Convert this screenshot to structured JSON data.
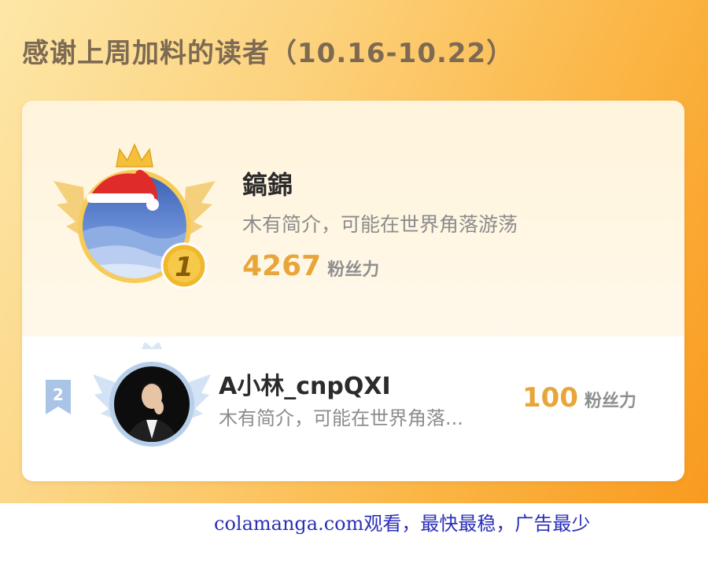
{
  "headline": "感谢上周加料的读者（10.16-10.22）",
  "leaderboard": [
    {
      "rank": "1",
      "name": "鎬錦",
      "bio": "木有简介，可能在世界角落游荡",
      "fans_value": "4267",
      "fans_unit": "粉丝力"
    },
    {
      "rank": "2",
      "name": "A小林_cnpQXI",
      "bio": "木有简介，可能在世界角落...",
      "fans_value": "100",
      "fans_unit": "粉丝力"
    }
  ],
  "footer": "colamanga.com观看，最快最稳，广告最少",
  "colors": {
    "gold": "#e8a53a",
    "silver": "#b8cfe9",
    "footer_text": "#2a2fb8",
    "headline_text": "#7d6a52"
  }
}
